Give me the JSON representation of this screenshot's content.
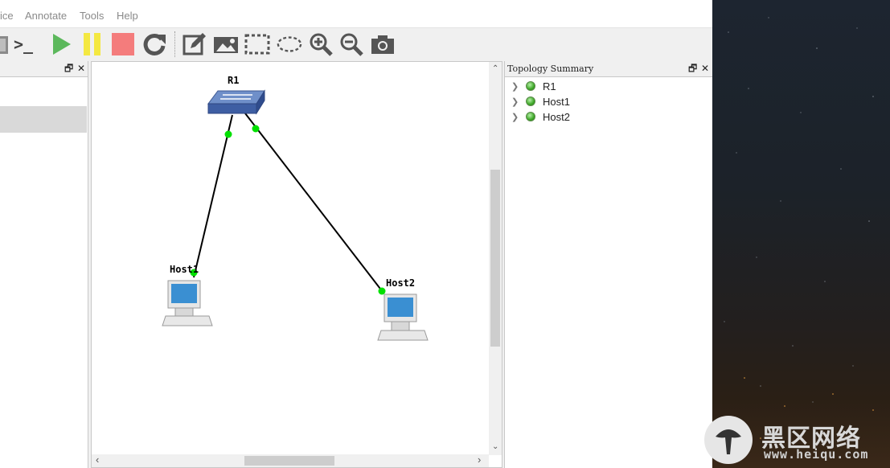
{
  "menu": {
    "items": [
      "ice",
      "Annotate",
      "Tools",
      "Help"
    ]
  },
  "toolbar": {
    "buttons": [
      {
        "name": "console-icon",
        "label": ">_"
      },
      {
        "name": "start-icon",
        "color": "#5cb85c"
      },
      {
        "name": "suspend-icon",
        "color": "#f4e842"
      },
      {
        "name": "stop-icon",
        "color": "#f47c7c"
      },
      {
        "name": "reload-icon"
      },
      {
        "name": "add-note-icon"
      },
      {
        "name": "insert-picture-icon"
      },
      {
        "name": "draw-rectangle-icon"
      },
      {
        "name": "draw-ellipse-icon"
      },
      {
        "name": "zoom-in-icon"
      },
      {
        "name": "zoom-out-icon"
      },
      {
        "name": "screenshot-icon"
      }
    ]
  },
  "topology": {
    "nodes": [
      {
        "id": "R1",
        "label": "R1",
        "type": "switch"
      },
      {
        "id": "Host1",
        "label": "Host1",
        "type": "computer"
      },
      {
        "id": "Host2",
        "label": "Host2",
        "type": "computer"
      }
    ],
    "links": [
      {
        "from": "R1",
        "to": "Host1",
        "status": "up",
        "color": "#00e000"
      },
      {
        "from": "R1",
        "to": "Host2",
        "status": "up",
        "color": "#00e000"
      }
    ]
  },
  "summary": {
    "title": "Topology Summary",
    "items": [
      {
        "label": "R1",
        "status": "started"
      },
      {
        "label": "Host1",
        "status": "started"
      },
      {
        "label": "Host2",
        "status": "started"
      }
    ]
  },
  "dock_buttons": {
    "float": "🗗",
    "close": "✕"
  },
  "scroll": {
    "up": "⌃",
    "down": "⌄",
    "left": "‹",
    "right": "›"
  },
  "watermark": {
    "brand": "黑区网络",
    "url": "www.heiqu.com"
  }
}
